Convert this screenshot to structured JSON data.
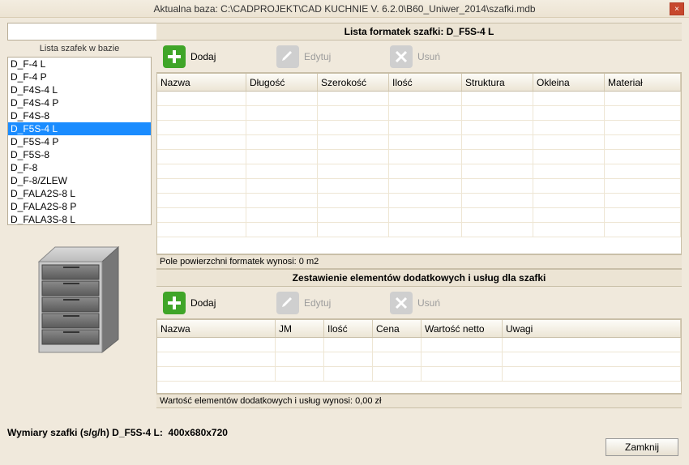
{
  "title": "Aktualna baza: C:\\CADPROJEKT\\CAD KUCHNIE V. 6.2.0\\B60_Uniwer_2014\\szafki.mdb",
  "search": {
    "placeholder": ""
  },
  "left": {
    "list_title": "Lista szafek w bazie",
    "items": [
      "D_F-4 L",
      "D_F-4 P",
      "D_F4S-4 L",
      "D_F4S-4 P",
      "D_F4S-8",
      "D_F5S-4 L",
      "D_F5S-4 P",
      "D_F5S-8",
      "D_F-8",
      "D_F-8/ZLEW",
      "D_FALA2S-8 L",
      "D_FALA2S-8 P",
      "D_FALA3S-8 L"
    ],
    "selected_index": 5
  },
  "top": {
    "panel_title": "Lista formatek szafki: D_F5S-4 L",
    "btn_add": "Dodaj",
    "btn_edit": "Edytuj",
    "btn_del": "Usuń",
    "cols": [
      "Nazwa",
      "Długość",
      "Szerokość",
      "Ilość",
      "Struktura",
      "Okleina",
      "Materiał"
    ],
    "status": "Pole powierzchni formatek wynosi: 0 m2"
  },
  "bottom": {
    "panel_title": "Zestawienie elementów dodatkowych i usług dla szafki",
    "btn_add": "Dodaj",
    "btn_edit": "Edytuj",
    "btn_del": "Usuń",
    "cols": [
      "Nazwa",
      "JM",
      "Ilość",
      "Cena",
      "Wartość netto",
      "Uwagi"
    ],
    "status": "Wartość elementów dodatkowych i usług wynosi: 0,00 zł"
  },
  "dims": {
    "label": "Wymiary szafki (s/g/h) D_F5S-4 L:",
    "value": "400x680x720"
  },
  "close_label": "Zamknij"
}
